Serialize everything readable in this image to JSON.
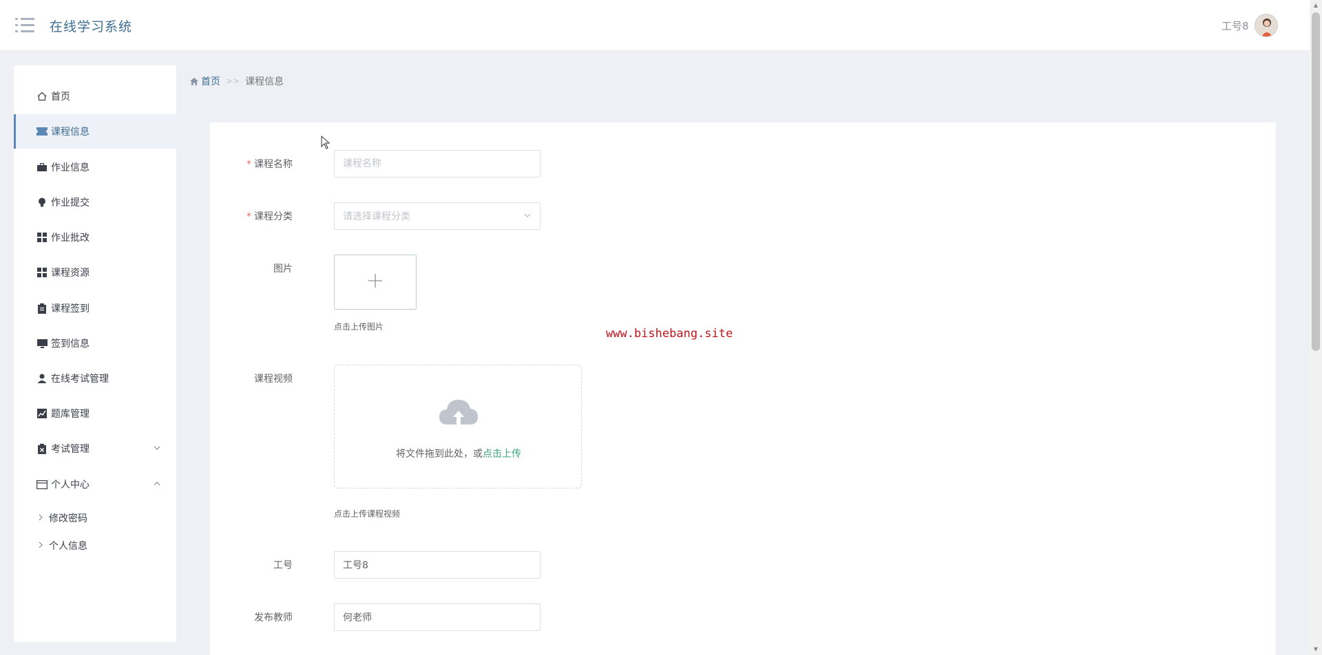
{
  "header": {
    "app_title": "在线学习系统",
    "user_name": "工号8"
  },
  "sidebar": {
    "items": [
      {
        "label": "首页",
        "icon": "home-icon"
      },
      {
        "label": "课程信息",
        "icon": "ticket-icon",
        "active": true
      },
      {
        "label": "作业信息",
        "icon": "briefcase-icon"
      },
      {
        "label": "作业提交",
        "icon": "bulb-icon"
      },
      {
        "label": "作业批改",
        "icon": "grid-icon"
      },
      {
        "label": "课程资源",
        "icon": "grid-icon"
      },
      {
        "label": "课程签到",
        "icon": "clipboard-icon"
      },
      {
        "label": "签到信息",
        "icon": "monitor-icon"
      },
      {
        "label": "在线考试管理",
        "icon": "user-icon"
      },
      {
        "label": "题库管理",
        "icon": "chart-icon"
      },
      {
        "label": "考试管理",
        "icon": "clipboard-x-icon",
        "expanded": false
      },
      {
        "label": "个人中心",
        "icon": "wallet-icon",
        "expanded": true
      }
    ],
    "sub_items": [
      {
        "label": "修改密码"
      },
      {
        "label": "个人信息"
      }
    ]
  },
  "breadcrumb": {
    "home": "首页",
    "separator": ">>",
    "current": "课程信息"
  },
  "form": {
    "course_name": {
      "label": "课程名称",
      "required": true,
      "value": "",
      "placeholder": "课程名称"
    },
    "course_category": {
      "label": "课程分类",
      "required": true,
      "placeholder": "请选择课程分类"
    },
    "image": {
      "label": "图片",
      "hint": "点击上传图片"
    },
    "video": {
      "label": "课程视频",
      "drag_text": "将文件拖到此处，或",
      "drag_link": "点击上传",
      "hint": "点击上传课程视频"
    },
    "employee_no": {
      "label": "工号",
      "value": "工号8"
    },
    "teacher": {
      "label": "发布教师",
      "value": "何老师"
    }
  },
  "watermark": "www.bishebang.site",
  "colors": {
    "brand": "#3d6e91",
    "required": "#f56c6c",
    "link": "#3aa37a",
    "watermark": "#c0141c"
  }
}
